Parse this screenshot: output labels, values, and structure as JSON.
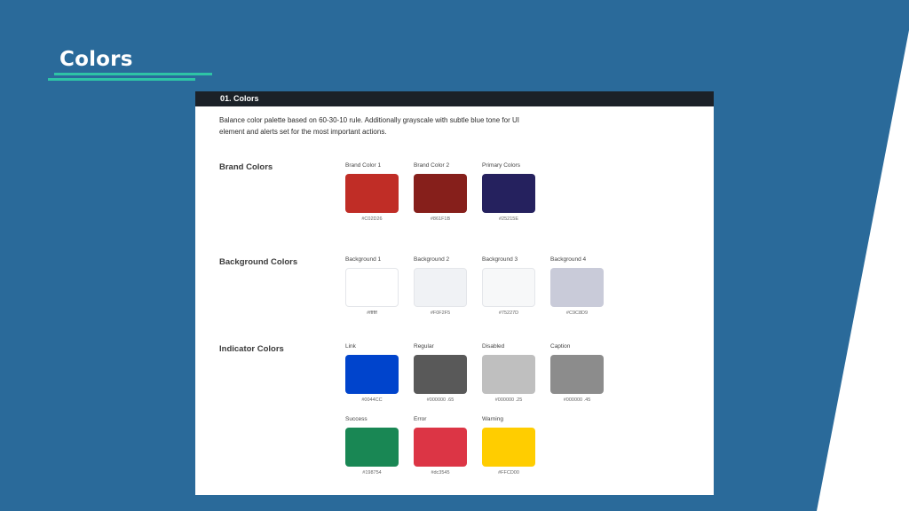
{
  "slide": {
    "title": "Colors",
    "background_color": "#2a6a9a",
    "accent_color": "#2ec4a6"
  },
  "card": {
    "header": "01. Colors",
    "description": "Balance color palette based on 60-30-10 rule. Additionally grayscale with subtle blue tone for UI element and alerts set for the most important actions."
  },
  "sections": {
    "brand": {
      "title": "Brand Colors",
      "swatches": [
        {
          "label": "Brand Color 1",
          "hex": "#C02D26",
          "color": "#C02D26"
        },
        {
          "label": "Brand Color 2",
          "hex": "#861F1B",
          "color": "#861F1B"
        },
        {
          "label": "Primary Colors",
          "hex": "#25215E",
          "color": "#25215E"
        }
      ]
    },
    "background": {
      "title": "Background Colors",
      "swatches": [
        {
          "label": "Background 1",
          "hex": "#ffffff",
          "color": "#ffffff"
        },
        {
          "label": "Background 2",
          "hex": "#F0F2F5",
          "color": "#F0F2F5"
        },
        {
          "label": "Background 3",
          "hex": "#75227D",
          "color": "#F7F8F9"
        },
        {
          "label": "Background 4",
          "hex": "#C9C8D9",
          "color": "#C9CBD9"
        }
      ]
    },
    "indicator": {
      "title": "Indicator Colors",
      "swatches": [
        {
          "label": "Link",
          "hex": "#0044CC",
          "color": "#0044CC"
        },
        {
          "label": "Regular",
          "hex": "#000000 .65",
          "color": "#595959"
        },
        {
          "label": "Disabled",
          "hex": "#000000 .25",
          "color": "#BFBFBF"
        },
        {
          "label": "Caption",
          "hex": "#000000 .45",
          "color": "#8C8C8C"
        },
        {
          "label": "Success",
          "hex": "#198754",
          "color": "#198754"
        },
        {
          "label": "Error",
          "hex": "#dc3545",
          "color": "#DC3545"
        },
        {
          "label": "Warning",
          "hex": "#FFCD00",
          "color": "#FFCD00"
        }
      ]
    }
  }
}
